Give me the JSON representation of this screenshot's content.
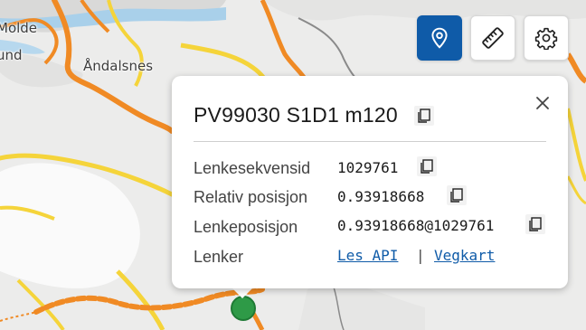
{
  "map": {
    "place_labels": [
      "Molde",
      "und",
      "Åndalsnes"
    ],
    "marker_color": "#2e9a47",
    "road_colors": {
      "major": "#f08a24",
      "secondary": "#f5d43a",
      "local": "#8a8a8a"
    }
  },
  "toolbar": {
    "buttons": [
      {
        "name": "location-pin-button",
        "icon": "map-pin-icon",
        "active": true
      },
      {
        "name": "measure-button",
        "icon": "ruler-icon",
        "active": false
      },
      {
        "name": "settings-button",
        "icon": "gear-icon",
        "active": false
      }
    ],
    "accent": "#0f5ba8"
  },
  "popup": {
    "title": "PV99030 S1D1 m120",
    "rows": [
      {
        "label": "Lenkesekvensid",
        "value": "1029761"
      },
      {
        "label": "Relativ posisjon",
        "value": "0.93918668"
      },
      {
        "label": "Lenkeposisjon",
        "value": "0.93918668@1029761"
      }
    ],
    "links_label": "Lenker",
    "links": [
      {
        "label": "Les API"
      },
      {
        "label": "Vegkart"
      }
    ],
    "links_separator": "|"
  }
}
